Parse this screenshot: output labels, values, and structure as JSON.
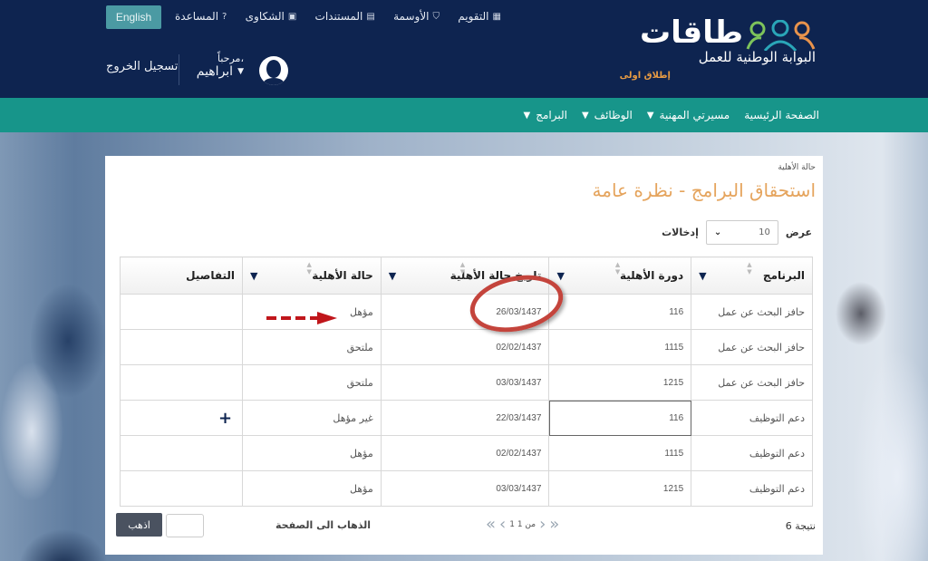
{
  "header": {
    "language_button": "English",
    "top_links": [
      {
        "label": "التقويم",
        "icon": "calendar-icon",
        "glyph": "▦"
      },
      {
        "label": "الأوسمة",
        "icon": "badge-shield-icon",
        "glyph": "⛉"
      },
      {
        "label": "المستندات",
        "icon": "documents-icon",
        "glyph": "▤"
      },
      {
        "label": "الشكاوى",
        "icon": "comment-icon",
        "glyph": "▣"
      },
      {
        "label": "المساعدة",
        "icon": "help-icon",
        "glyph": "?"
      }
    ],
    "welcome": "مرحباً،",
    "user_name": "ابراهيم",
    "logout": "تسجيل الخروج",
    "logo": {
      "name": "طاقات",
      "subtitle": "البوابة الوطنية للعمل",
      "tagline": "إطلاق اولى"
    }
  },
  "mainnav": {
    "items": [
      {
        "label": "الصفحة الرئيسية",
        "dropdown": false
      },
      {
        "label": "مسيرتي المهنية",
        "dropdown": true
      },
      {
        "label": "الوظائف",
        "dropdown": true
      },
      {
        "label": "البرامج",
        "dropdown": true
      }
    ]
  },
  "page": {
    "breadcrumb": "حالة الأهلية",
    "title": "استحقاق البرامج - نظرة عامة",
    "show_label": "عرض",
    "entries_value": "10",
    "entries_label": "إدخالات"
  },
  "table": {
    "columns": [
      "البرنامج",
      "دورة الأهلية",
      "تاريخ حالة الأهلية",
      "حالة الأهلية",
      "التفاصيل"
    ],
    "rows": [
      {
        "program": "حافز البحث عن عمل",
        "cycle": "116",
        "date": "26/03/1437",
        "status": "مؤهل",
        "details": ""
      },
      {
        "program": "حافز البحث عن عمل",
        "cycle": "1115",
        "date": "02/02/1437",
        "status": "ملتحق",
        "details": ""
      },
      {
        "program": "حافز البحث عن عمل",
        "cycle": "1215",
        "date": "03/03/1437",
        "status": "ملتحق",
        "details": ""
      },
      {
        "program": "دعم التوظيف",
        "cycle": "116",
        "date": "22/03/1437",
        "status": "غير مؤهل",
        "details": "+"
      },
      {
        "program": "دعم التوظيف",
        "cycle": "1115",
        "date": "02/02/1437",
        "status": "مؤهل",
        "details": ""
      },
      {
        "program": "دعم التوظيف",
        "cycle": "1215",
        "date": "03/03/1437",
        "status": "مؤهل",
        "details": ""
      }
    ]
  },
  "footer": {
    "result_count": "6 نتيجة",
    "page_info": "1 من 1",
    "goto_label": "الذهاب الى الصفحة",
    "goto_value": "",
    "go_button": "اذهب"
  },
  "colors": {
    "header_bg": "#0e2450",
    "nav_bg": "#17958a",
    "title": "#e5a45d",
    "annotation_red": "#c4443c"
  }
}
